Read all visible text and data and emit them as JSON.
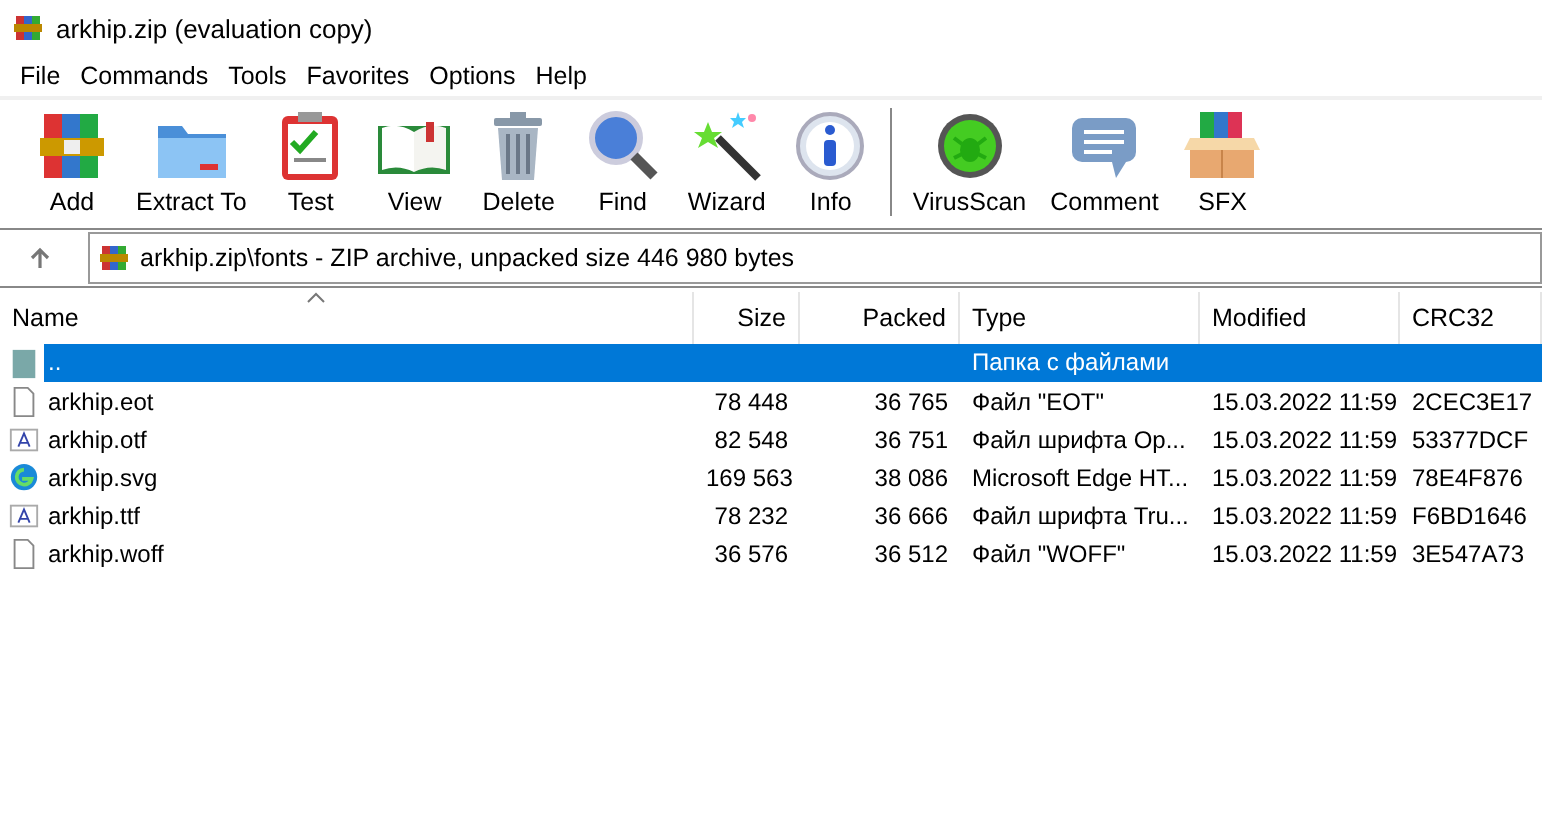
{
  "window": {
    "title": "arkhip.zip (evaluation copy)"
  },
  "menu": [
    "File",
    "Commands",
    "Tools",
    "Favorites",
    "Options",
    "Help"
  ],
  "toolbar": {
    "groups": [
      [
        {
          "kind": "add",
          "label": "Add"
        },
        {
          "kind": "extract",
          "label": "Extract To"
        },
        {
          "kind": "test",
          "label": "Test"
        },
        {
          "kind": "view",
          "label": "View"
        },
        {
          "kind": "delete",
          "label": "Delete"
        },
        {
          "kind": "find",
          "label": "Find"
        },
        {
          "kind": "wizard",
          "label": "Wizard"
        },
        {
          "kind": "info",
          "label": "Info"
        }
      ],
      [
        {
          "kind": "virusscan",
          "label": "VirusScan"
        },
        {
          "kind": "comment",
          "label": "Comment"
        },
        {
          "kind": "sfx",
          "label": "SFX"
        }
      ]
    ]
  },
  "address": {
    "path": "arkhip.zip\\fonts - ZIP archive, unpacked size 446 980 bytes"
  },
  "table": {
    "columns": [
      "Name",
      "Size",
      "Packed",
      "Type",
      "Modified",
      "CRC32"
    ],
    "rows": [
      {
        "kind": "folder-up",
        "selected": true,
        "cells": [
          "..",
          "",
          "",
          "Папка с файлами",
          "",
          ""
        ]
      },
      {
        "kind": "blank",
        "selected": false,
        "cells": [
          "arkhip.eot",
          "78 448",
          "36 765",
          "Файл \"EOT\"",
          "15.03.2022 11:59",
          "2CEC3E17"
        ]
      },
      {
        "kind": "font",
        "selected": false,
        "cells": [
          "arkhip.otf",
          "82 548",
          "36 751",
          "Файл шрифта Op...",
          "15.03.2022 11:59",
          "53377DCF"
        ]
      },
      {
        "kind": "edge",
        "selected": false,
        "cells": [
          "arkhip.svg",
          "169 563",
          "38 086",
          "Microsoft Edge HT...",
          "15.03.2022 11:59",
          "78E4F876"
        ]
      },
      {
        "kind": "font",
        "selected": false,
        "cells": [
          "arkhip.ttf",
          "78 232",
          "36 666",
          "Файл шрифта Tru...",
          "15.03.2022 11:59",
          "F6BD1646"
        ]
      },
      {
        "kind": "blank",
        "selected": false,
        "cells": [
          "arkhip.woff",
          "36 576",
          "36 512",
          "Файл \"WOFF\"",
          "15.03.2022 11:59",
          "3E547A73"
        ]
      }
    ]
  }
}
